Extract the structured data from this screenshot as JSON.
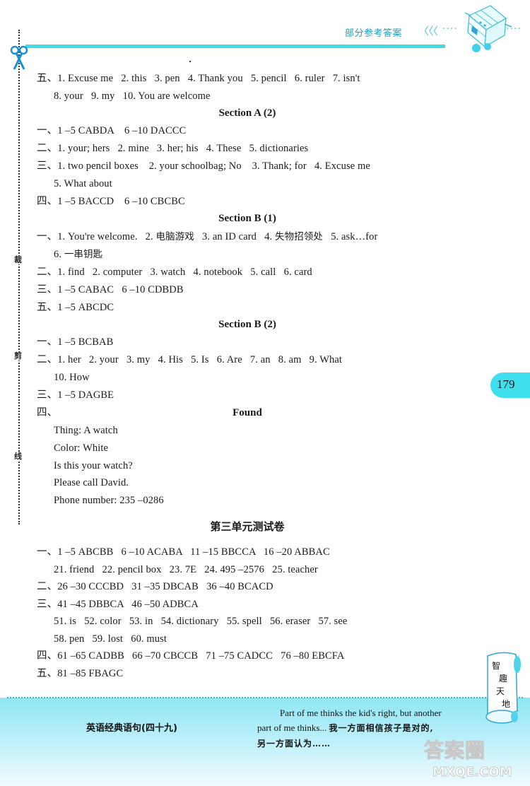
{
  "header": {
    "label": "部分参考答案",
    "chevrons": "〈〈〈",
    "dots": "····",
    "accent_color": "#3fdbe6"
  },
  "cut_line": {
    "chars": [
      "裁",
      "剪",
      "线"
    ]
  },
  "page_number": "179",
  "content": {
    "intro": [
      "五、1. Excuse me   2. this   3. pen   4. Thank you   5. pencil   6. ruler   7. isn't",
      "8. your   9. my   10. You are welcome"
    ],
    "section_a2": {
      "title": "Section A (2)",
      "lines": [
        "一、1 –5 CABDA    6 –10 DACCC",
        "二、1. your; hers   2. mine   3. her; his   4. These   5. dictionaries",
        "三、1. two pencil boxes    2. your schoolbag; No    3. Thank; for   4. Excuse me",
        "5. What about",
        "四、1 –5 BACCD    6 –10 CBCBC"
      ]
    },
    "section_b1": {
      "title": "Section B (1)",
      "line1_parts": [
        "一、1. You're welcome.   2. ",
        "电脑游戏",
        "   3. an ID card   4. ",
        "失物招领处",
        "   5. ask…for"
      ],
      "line2_parts": [
        "6. ",
        "一串钥匙"
      ],
      "lines": [
        "二、1. find   2. computer   3. watch   4. notebook   5. call   6. card",
        "三、1 –5 CABAC   6 –10 CDBDB",
        "五、1 –5 ABCDC"
      ]
    },
    "section_b2": {
      "title": "Section B (2)",
      "lines": [
        "一、1 –5 BCBAB",
        "二、1. her   2. your   3. my   4. His   5. Is   6. Are   7. an   8. am   9. What",
        "10. How",
        "三、1 –5 DAGBE",
        "四、"
      ],
      "notice": {
        "title": "Found",
        "lines": [
          "Thing: A watch",
          "Color: White",
          "Is this your watch?",
          "Please call David.",
          "Phone number: 235 –0286"
        ]
      }
    },
    "unit3_test": {
      "title": "第三单元测试卷",
      "lines": [
        "一、1 –5 ABCBB   6 –10 ACABA   11 –15 BBCCA   16 –20 ABBAC",
        "21. friend   22. pencil box   23. 7E   24. 495 –2576   25. teacher",
        "二、26 –30 CCCBD   31 –35 DBCAB   36 –40 BCACD",
        "三、41 –45 DBBCA   46 –50 ADBCA",
        "51. is   52. color   53. in   54. dictionary   55. spell   56. eraser   57. see",
        "58. pen   59. lost   60. must",
        "四、61 –65 CADBB   66 –70 CBCCB   71 –75 CADCC   76 –80 EBCFA",
        "五、81 –85 FBAGC"
      ]
    }
  },
  "footer": {
    "title": "英语经典语句(四十九)",
    "quote_en_1": "Part of me thinks the kid's right, but another",
    "quote_en_2": "part of me thinks... ",
    "quote_cn_1": "我一方面相信孩子是对的,",
    "quote_cn_2": "另一方面认为……",
    "scroll_text": [
      "智",
      "趣",
      "天",
      "地"
    ],
    "watermark_1": "答案圈",
    "watermark_2": "MXQE.COM"
  }
}
